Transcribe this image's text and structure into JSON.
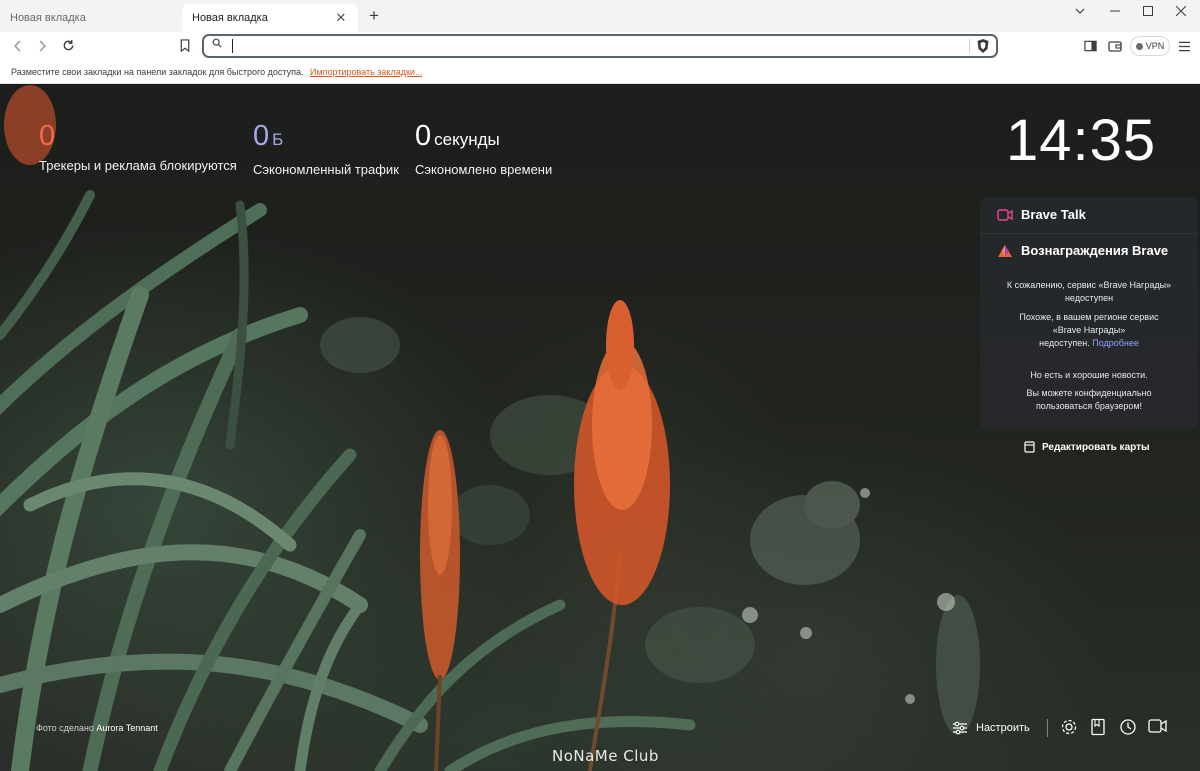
{
  "browser": {
    "tabs": [
      {
        "label": "Новая вкладка",
        "active": false
      },
      {
        "label": "Новая вкладка",
        "active": true
      }
    ],
    "new_tab_symbol": "+",
    "address": {
      "value": "",
      "placeholder": ""
    },
    "vpn_label": "VPN",
    "bookmarks_bar": {
      "text": "Разместите свои закладки на панели закладок для быстрого доступа.",
      "link": "Импортировать закладки..."
    }
  },
  "stats": [
    {
      "value": "0",
      "unit": "",
      "label": "Трекеры и реклама блокируются",
      "color": "#f06a4d"
    },
    {
      "value": "0",
      "unit": "Б",
      "label": "Сэкономленный трафик",
      "color": "#a8a6e8"
    },
    {
      "value": "0",
      "unit": "секунды",
      "label": "Сэкономлено времени",
      "color": "#ffffff"
    }
  ],
  "clock": "14:35",
  "cards": {
    "talk_title": "Brave Talk",
    "rewards_title": "Вознаграждения Brave",
    "unavailable_line1": "К сожалению, сервис «Brave Награды»",
    "unavailable_line2": "недоступен",
    "region_line1": "Похоже, в вашем регионе сервис",
    "region_line2": "«Brave Награды»",
    "region_line3": "недоступен.",
    "more_link": "Подробнее",
    "good_news": "Но есть и хорошие новости.",
    "private_line1": "Вы можете конфиденциально",
    "private_line2": "пользоваться браузером!",
    "edit_cards": "Редактировать карты"
  },
  "photo_credit": {
    "prefix": "Фото сделано",
    "author": "Aurora Tennant"
  },
  "watermark": "NoNaMe Club",
  "bottom": {
    "customize": "Настроить"
  },
  "icons": [
    "back-icon",
    "forward-icon",
    "reload-icon",
    "bookmark-icon",
    "search-icon",
    "brave-shield-icon",
    "sidebar-icon",
    "wallet-icon",
    "menu-icon",
    "settings-gear-icon",
    "bookmarks-icon",
    "history-icon",
    "brave-talk-icon"
  ],
  "colors": {
    "accent": "#d55a1e",
    "link": "#8ea2ff",
    "tracker_count": "#f06a4d",
    "bandwidth": "#a8a6e8"
  }
}
